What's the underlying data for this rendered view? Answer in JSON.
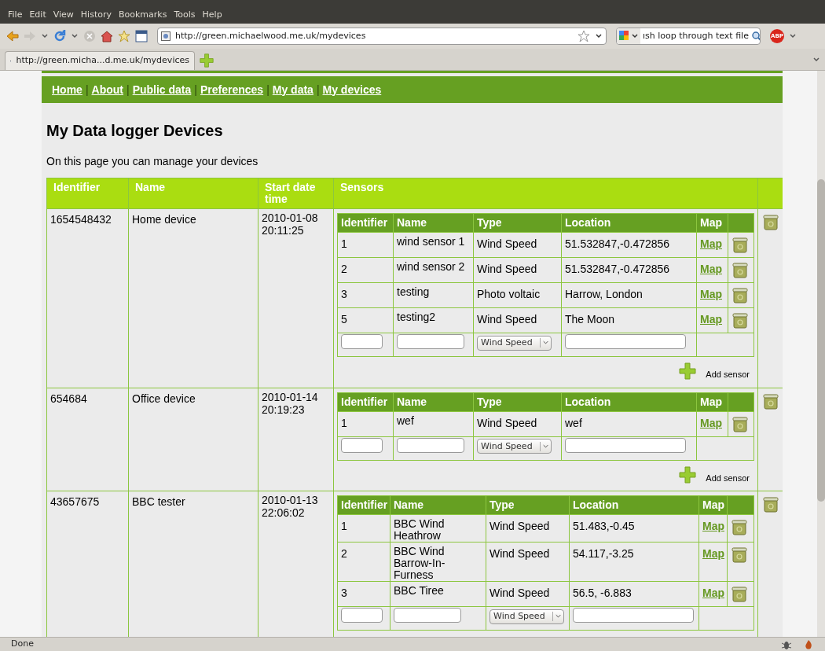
{
  "browser": {
    "menu": [
      "File",
      "Edit",
      "View",
      "History",
      "Bookmarks",
      "Tools",
      "Help"
    ],
    "url": "http://green.michaelwood.me.uk/mydevices",
    "search_value": "ısh loop through text file",
    "adblock_badge": "ABP",
    "tab_title": "http://green.micha...d.me.uk/mydevices",
    "status": "Done"
  },
  "nav": [
    {
      "label": "Home"
    },
    {
      "separator": "|",
      "label": "About"
    },
    {
      "separator": "|",
      "label": "Public data"
    },
    {
      "separator": "|",
      "label": "Preferences"
    },
    {
      "separator": "|",
      "label": "My data"
    },
    {
      "separator": "|",
      "label": "My devices"
    }
  ],
  "page": {
    "title": "My Data logger Devices",
    "intro": "On this page you can manage your devices"
  },
  "devices_table": {
    "columns": [
      "Identifier",
      "Name",
      "Start date time",
      "Sensors"
    ],
    "devices": [
      {
        "identifier": "1654548432",
        "sensor_columns": [
          "Identifier",
          "Name",
          "Type",
          "Location",
          "Map"
        ],
        "name": "Home device",
        "start": "2010-01-08 20:11:25",
        "new_sensor_type": "Wind Speed",
        "add_label": "Add sensor",
        "sensors": [
          {
            "identifier": "1",
            "name": "wind sensor 1",
            "type": "Wind Speed",
            "location": "51.532847,-0.472856",
            "map": "Map"
          },
          {
            "identifier": "2",
            "name": "wind sensor 2",
            "type": "Wind Speed",
            "location": "51.532847,-0.472856",
            "map": "Map"
          },
          {
            "identifier": "3",
            "name": "testing",
            "type": "Photo voltaic",
            "location": "Harrow, London",
            "map": "Map"
          },
          {
            "identifier": "5",
            "name": "testing2",
            "type": "Wind Speed",
            "location": "The Moon",
            "map": "Map"
          }
        ]
      },
      {
        "identifier": "654684",
        "sensor_columns": [
          "Identifier",
          "Name",
          "Type",
          "Location",
          "Map"
        ],
        "name": "Office device",
        "start": "2010-01-14 20:19:23",
        "new_sensor_type": "Wind Speed",
        "add_label": "Add sensor",
        "sensors": [
          {
            "identifier": "1",
            "name": "wef",
            "type": "Wind Speed",
            "location": "wef",
            "map": "Map"
          }
        ]
      },
      {
        "identifier": "43657675",
        "sensor_columns": [
          "Identifier",
          "Name",
          "Type",
          "Location",
          "Map"
        ],
        "name": "BBC tester",
        "start": "2010-01-13 22:06:02",
        "new_sensor_type": "Wind Speed",
        "sensors": [
          {
            "identifier": "1",
            "name": "BBC Wind Heathrow",
            "type": "Wind Speed",
            "location": "51.483,-0.45",
            "map": "Map"
          },
          {
            "identifier": "2",
            "name": "BBC Wind Barrow-In-Furness",
            "type": "Wind Speed",
            "location": "54.117,-3.25",
            "map": "Map"
          },
          {
            "identifier": "3",
            "name": "BBC Tiree",
            "type": "Wind Speed",
            "location": "56.5, -6.883",
            "map": "Map"
          }
        ]
      }
    ]
  }
}
